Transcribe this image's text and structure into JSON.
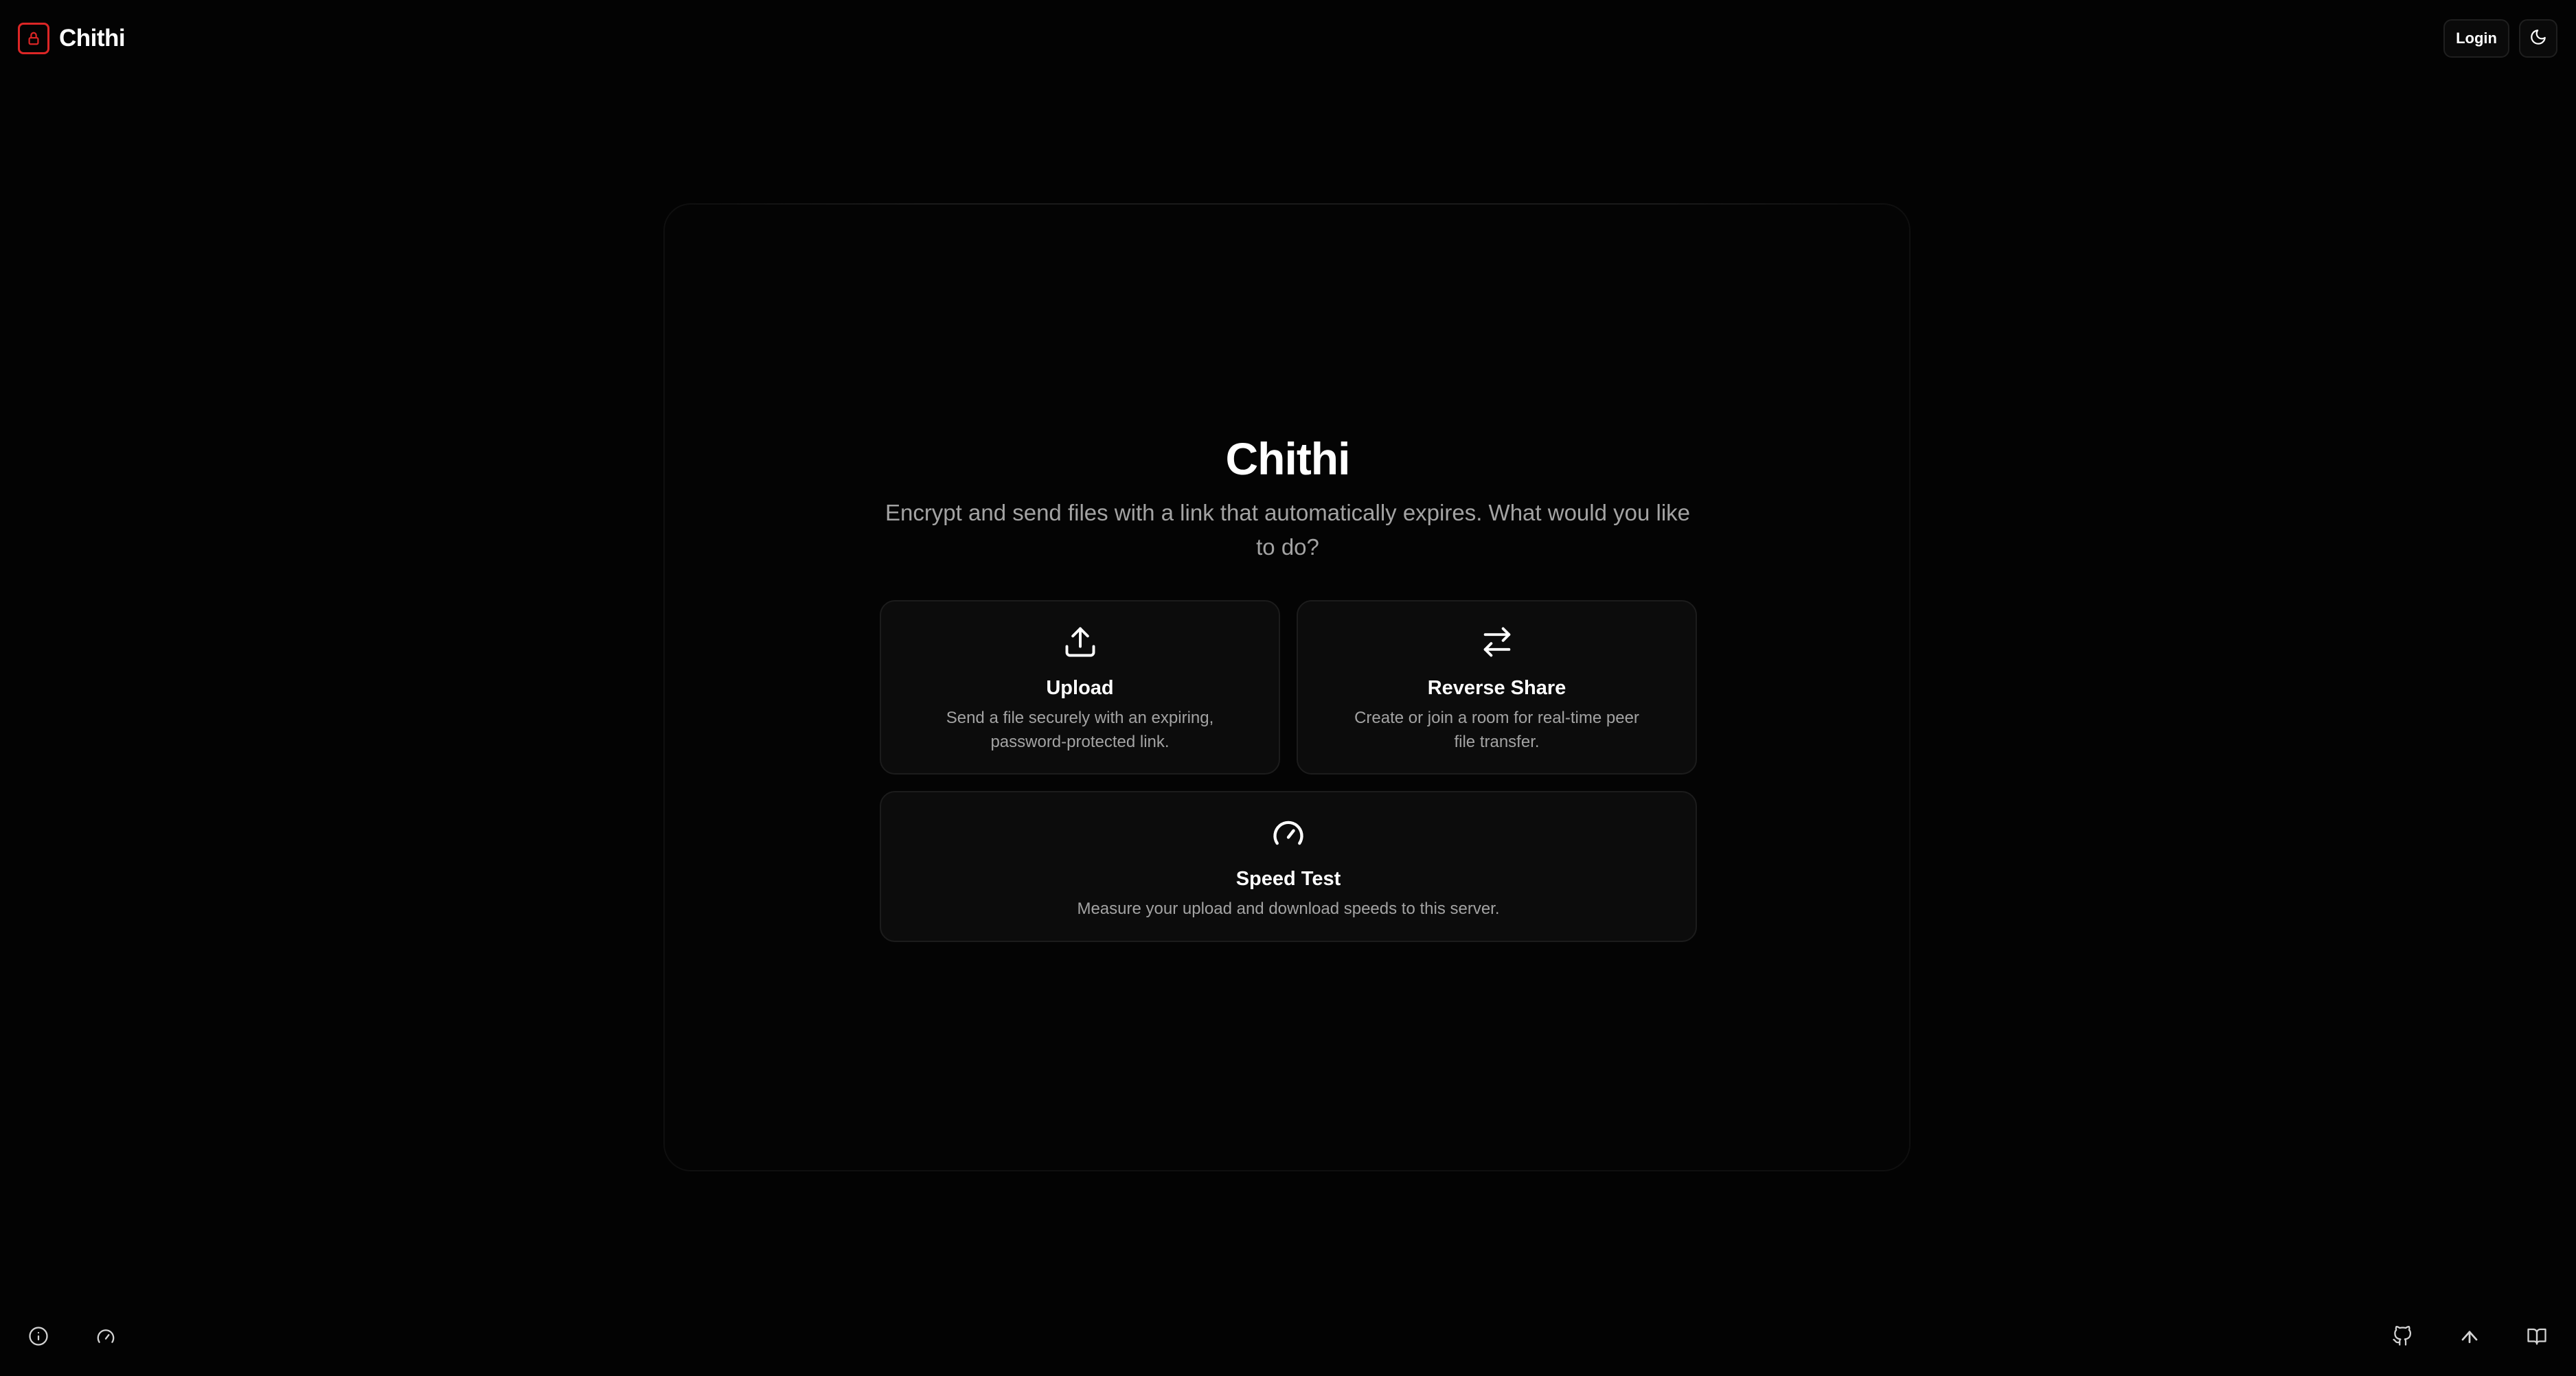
{
  "header": {
    "app_name": "Chithi",
    "logo_icon": "lock-icon",
    "login_label": "Login",
    "theme_toggle_icon": "moon-icon"
  },
  "hero": {
    "title": "Chithi",
    "subtitle": "Encrypt and send files with a link that automatically expires. What would you like to do?"
  },
  "cards": [
    {
      "icon": "upload-icon",
      "title": "Upload",
      "description": "Send a file securely with an expiring, password-protected link."
    },
    {
      "icon": "arrows-swap-icon",
      "title": "Reverse Share",
      "description": "Create or join a room for real-time peer file transfer."
    },
    {
      "icon": "gauge-icon",
      "title": "Speed Test",
      "description": "Measure your upload and download speeds to this server."
    }
  ],
  "footer": {
    "left_icons": [
      "info-icon",
      "gauge-icon"
    ],
    "right_icons": [
      "github-icon",
      "arrow-up-icon",
      "book-open-icon"
    ]
  },
  "colors": {
    "background": "#030303",
    "accent": "#dc2626",
    "text": "#ffffff",
    "muted": "#a3a3a3",
    "card_bg": "#0c0c0c",
    "card_border": "#1c1c1c"
  }
}
